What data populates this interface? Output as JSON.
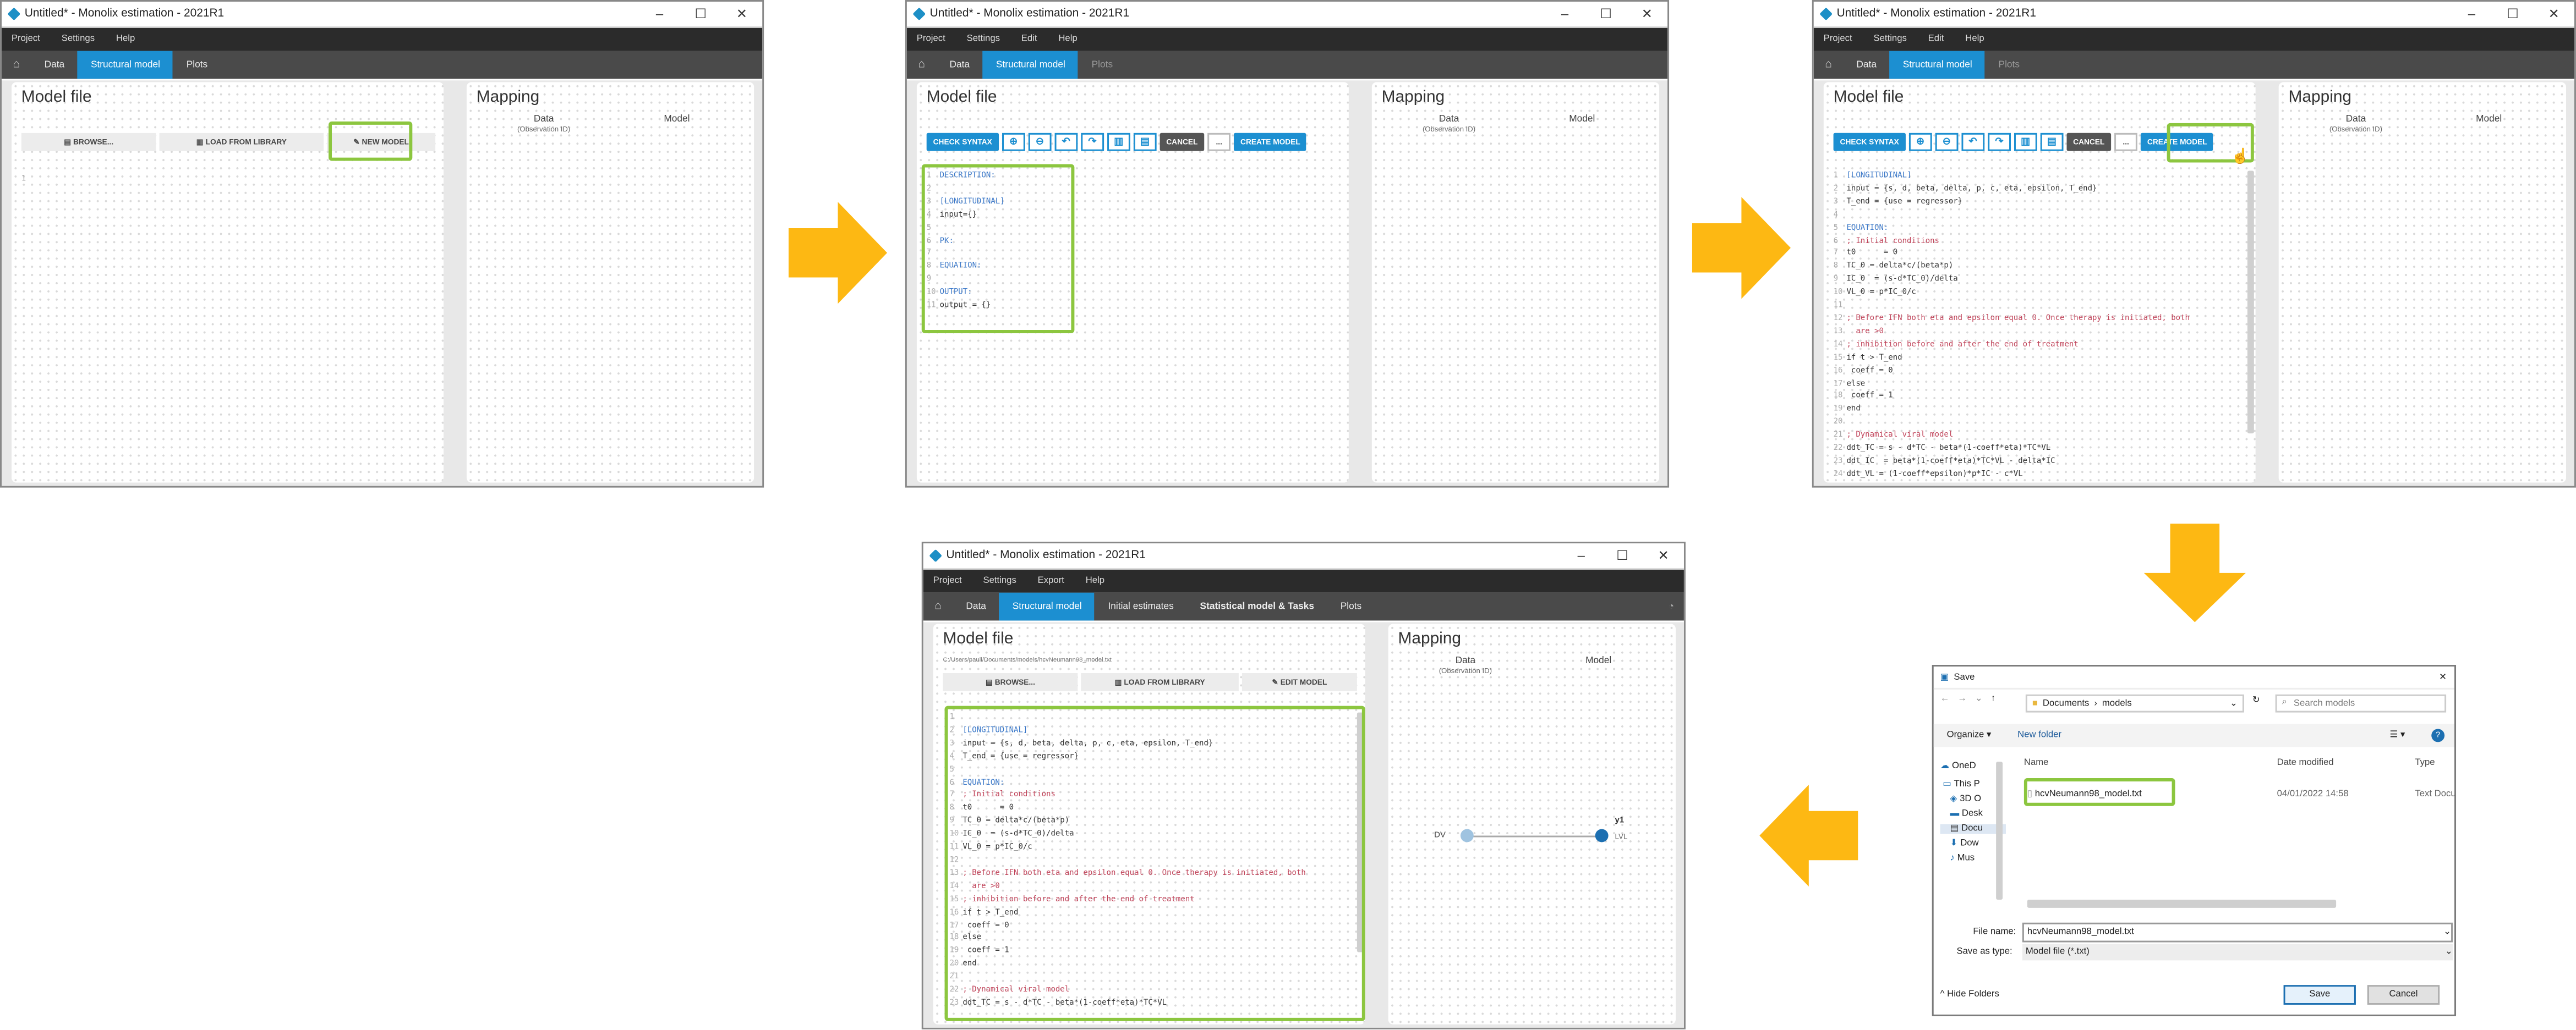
{
  "window_title": "Untitled* - Monolix estimation - 2021R1",
  "menus_short": [
    "Project",
    "Settings",
    "Help"
  ],
  "menus_edit": [
    "Project",
    "Settings",
    "Edit",
    "Help"
  ],
  "menus_full": [
    "Project",
    "Settings",
    "Export",
    "Help"
  ],
  "tabs_short": [
    "Data",
    "Structural model",
    "Plots"
  ],
  "tabs_full": [
    "Data",
    "Structural model",
    "Initial estimates",
    "Statistical model & Tasks",
    "Plots"
  ],
  "model_file_title": "Model file",
  "mapping_title": "Mapping",
  "mapping": {
    "data": "Data",
    "obs_id": "(Observation ID)",
    "model": "Model",
    "dv": "DV",
    "y1": "y1",
    "lvl": "LVL"
  },
  "buttons": {
    "browse": "BROWSE...",
    "load_library": "LOAD FROM LIBRARY",
    "new_model": "NEW MODEL",
    "edit_model": "EDIT MODEL",
    "check_syntax": "CHECK SYNTAX",
    "cancel": "CANCEL",
    "more": "...",
    "create_model": "CREATE MODEL"
  },
  "model_path": "C:/Users/pauli/Documents/models/hcvNeumann98_model.txt",
  "template_code": [
    {
      "t": "DESCRIPTION:",
      "k": "kw"
    },
    {
      "t": "",
      "k": ""
    },
    {
      "t": "[LONGITUDINAL]",
      "k": "kw"
    },
    {
      "t": "input={}",
      "k": ""
    },
    {
      "t": "",
      "k": ""
    },
    {
      "t": "PK:",
      "k": "kw"
    },
    {
      "t": "",
      "k": ""
    },
    {
      "t": "EQUATION:",
      "k": "kw"
    },
    {
      "t": "",
      "k": ""
    },
    {
      "t": "OUTPUT:",
      "k": "kw"
    },
    {
      "t": "output = {}",
      "k": ""
    }
  ],
  "model_code": [
    {
      "t": "[LONGITUDINAL]",
      "k": "kw"
    },
    {
      "t": "input = {s, d, beta, delta, p, c, eta, epsilon, T_end}",
      "k": ""
    },
    {
      "t": "T_end = {use = regressor}",
      "k": ""
    },
    {
      "t": "",
      "k": ""
    },
    {
      "t": "EQUATION:",
      "k": "kw"
    },
    {
      "t": "; Initial conditions",
      "k": "cm"
    },
    {
      "t": "t0      = 0",
      "k": ""
    },
    {
      "t": "TC_0 = delta*c/(beta*p)",
      "k": ""
    },
    {
      "t": "IC_0  = (s-d*TC_0)/delta",
      "k": ""
    },
    {
      "t": "VL_0 = p*IC_0/c",
      "k": ""
    },
    {
      "t": "",
      "k": ""
    },
    {
      "t": "; Before IFN both eta and epsilon equal 0. Once therapy is initiated, both",
      "k": "cm"
    },
    {
      "t": "  are >0",
      "k": "cm"
    },
    {
      "t": "; inhibition before and after the end of treatment",
      "k": "cm"
    },
    {
      "t": "if t > T_end",
      "k": ""
    },
    {
      "t": " coeff = 0",
      "k": ""
    },
    {
      "t": "else",
      "k": ""
    },
    {
      "t": " coeff = 1",
      "k": ""
    },
    {
      "t": "end",
      "k": ""
    },
    {
      "t": "",
      "k": ""
    },
    {
      "t": "; Dynamical viral model",
      "k": "cm"
    },
    {
      "t": "ddt_TC = s - d*TC - beta*(1-coeff*eta)*TC*VL",
      "k": ""
    },
    {
      "t": "ddt_IC  = beta*(1-coeff*eta)*TC*VL - delta*IC",
      "k": ""
    },
    {
      "t": "ddt_VL = (1-coeff*epsilon)*p*IC - c*VL",
      "k": ""
    }
  ],
  "save_dialog": {
    "title": "Save",
    "path": [
      "Documents",
      "models"
    ],
    "search_placeholder": "Search models",
    "organize": "Organize",
    "new_folder": "New folder",
    "col_name": "Name",
    "col_date": "Date modified",
    "col_type": "Type",
    "file_name": "hcvNeumann98_model.txt",
    "file_date": "04/01/2022 14:58",
    "file_type": "Text Docu",
    "nav": [
      "OneD",
      "This P",
      "3D O",
      "Desk",
      "Docu",
      "Dow",
      "Mus"
    ],
    "file_name_label": "File name:",
    "file_name_value": "hcvNeumann98_model.txt",
    "save_type_label": "Save as type:",
    "save_type_value": "Model file (*.txt)",
    "hide_folders": "Hide Folders",
    "save": "Save",
    "cancel": "Cancel"
  },
  "colors": {
    "accent": "#1c8fd1",
    "highlight": "#8cc63f",
    "arrow": "#fdb813"
  }
}
